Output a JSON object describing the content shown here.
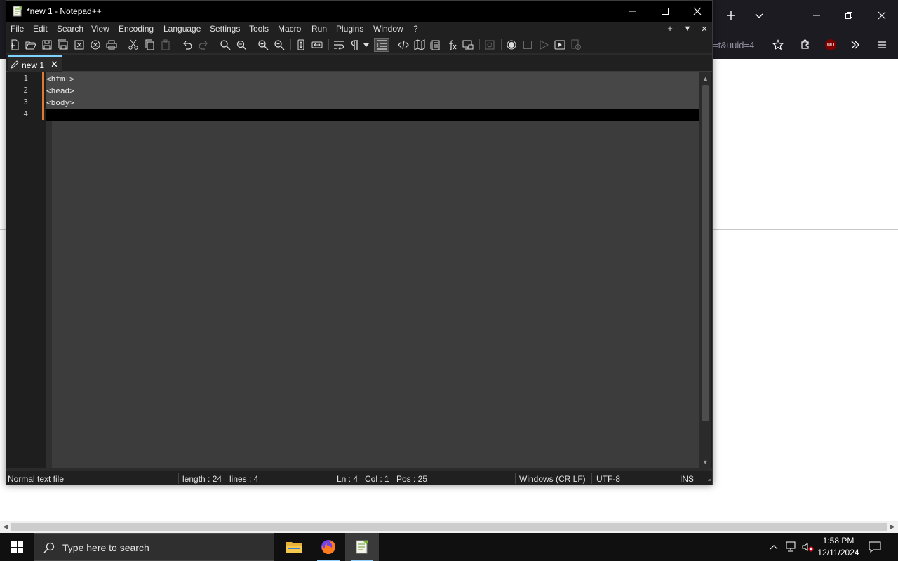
{
  "browser": {
    "url_fragment": "=t&uuid=4",
    "ublock_label": "UD"
  },
  "notepad": {
    "window_title": "*new 1 - Notepad++",
    "menu": [
      "File",
      "Edit",
      "Search",
      "View",
      "Encoding",
      "Language",
      "Settings",
      "Tools",
      "Macro",
      "Run",
      "Plugins",
      "Window",
      "?"
    ],
    "menu_right": {
      "plus": "+",
      "down": "▼",
      "close": "✕"
    },
    "tab": {
      "label": "new 1",
      "close": "✕"
    },
    "lines": [
      {
        "num": "1",
        "text": "<html>"
      },
      {
        "num": "2",
        "text": "<head>"
      },
      {
        "num": "3",
        "text": "<body>"
      },
      {
        "num": "4",
        "text": ""
      }
    ],
    "status": {
      "file_type": "Normal text file",
      "length": "length : 24",
      "lines": "lines : 4",
      "ln": "Ln : 4",
      "col": "Col : 1",
      "pos": "Pos : 25",
      "eol": "Windows (CR LF)",
      "encoding": "UTF-8",
      "mode": "INS"
    }
  },
  "taskbar": {
    "search_placeholder": "Type here to search",
    "time": "1:58 PM",
    "date": "12/11/2024"
  },
  "colors": {
    "accent_tab": "#7ed4ff",
    "change_bar": "#e07a2e",
    "editor_bg": "#3c3c3c"
  }
}
